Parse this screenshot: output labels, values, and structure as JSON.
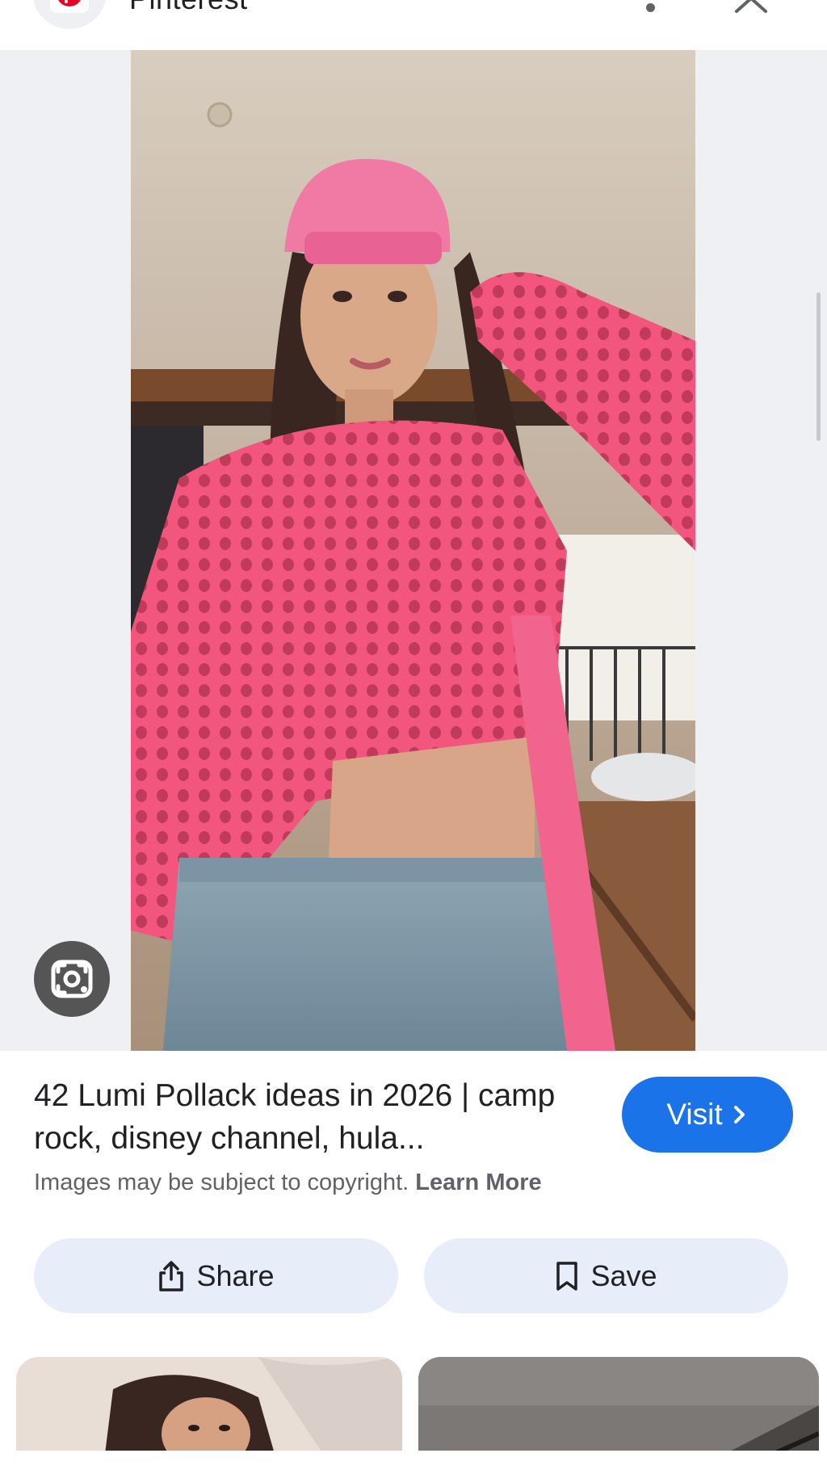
{
  "header": {
    "site_name": "Pinterest",
    "logo_letter": "p",
    "more_icon": "more-vert-icon",
    "close_icon": "close-icon"
  },
  "image_viewer": {
    "lens_icon": "google-lens-icon"
  },
  "result": {
    "title": "42 Lumi Pollack ideas in 2026 | camp rock, disney channel, hula...",
    "visit_label": "Visit",
    "copyright_text": "Images may be subject to copyright.",
    "learn_more_label": "Learn More"
  },
  "actions": {
    "share_label": "Share",
    "save_label": "Save"
  },
  "colors": {
    "accent": "#1a73e8",
    "action_bg": "#e8eef9",
    "brand": "#e60023",
    "viewer_bg": "#eef0f3"
  }
}
